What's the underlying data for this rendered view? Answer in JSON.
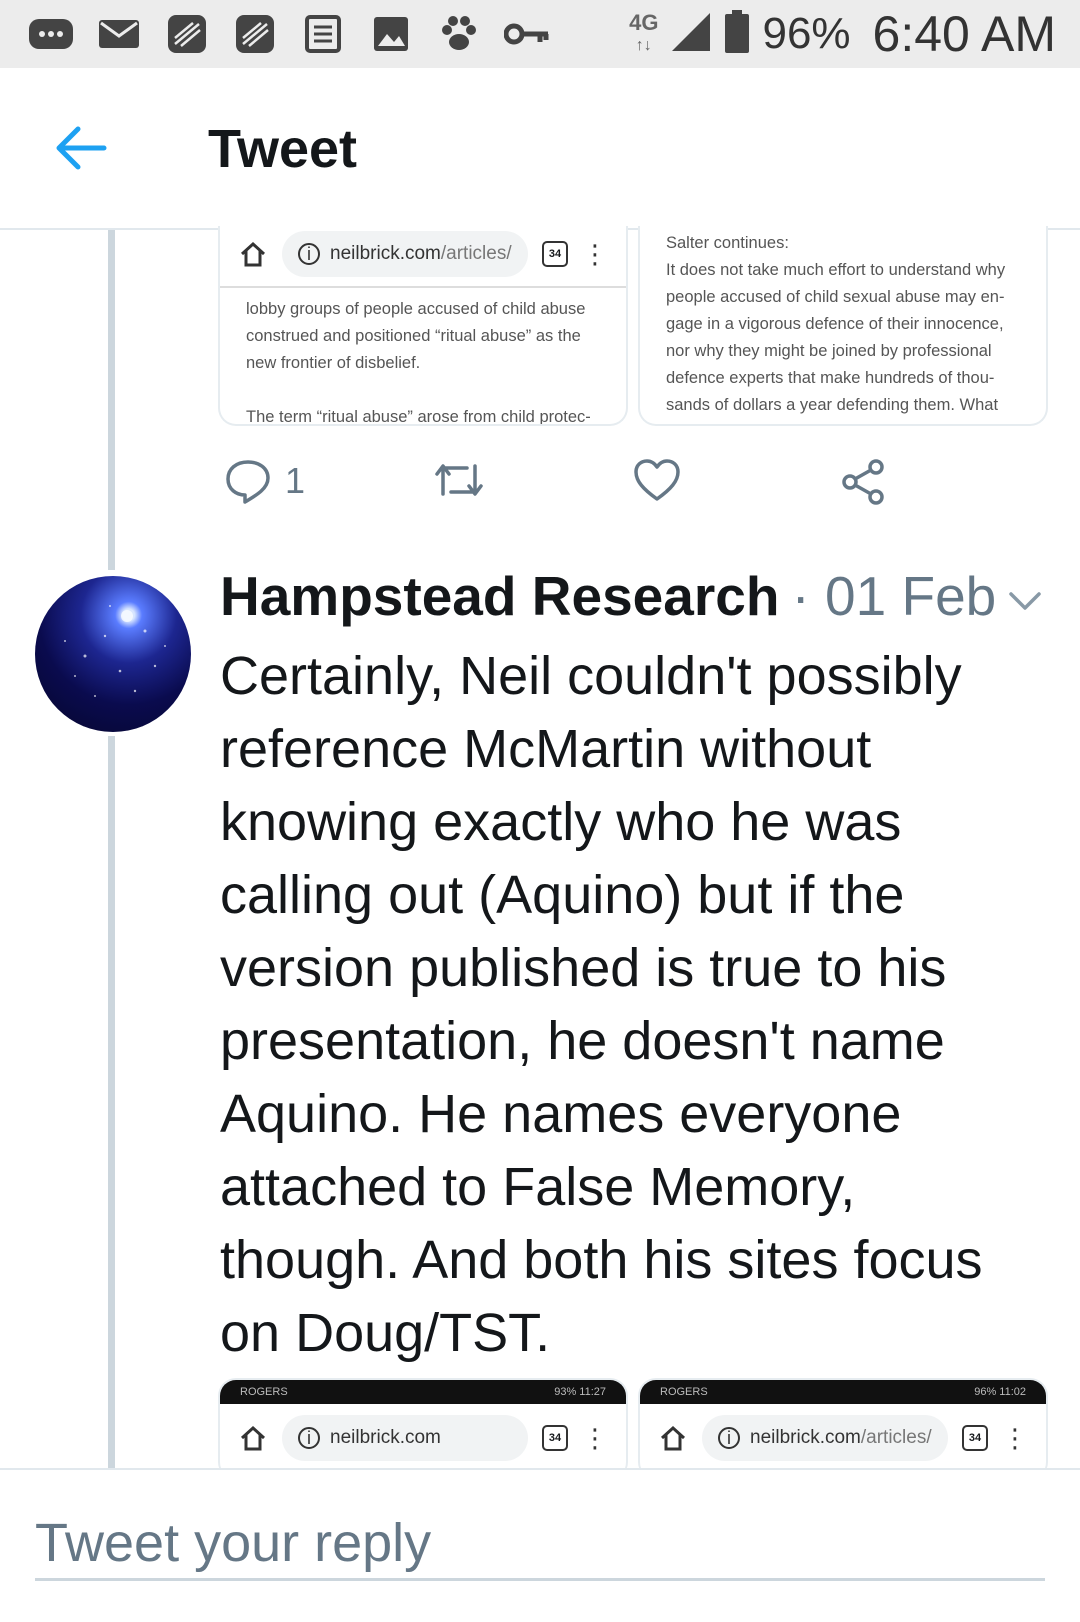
{
  "status_bar": {
    "battery": "96%",
    "time": "6:40 AM",
    "network": "4G",
    "icons": [
      "message-icon",
      "mail-icon",
      "blackberry-icon",
      "blackberry-icon",
      "news-icon",
      "image-icon",
      "paw-icon",
      "key-icon",
      "signal-icon",
      "battery-icon"
    ]
  },
  "header": {
    "title": "Tweet",
    "back_icon": "arrow-left-icon"
  },
  "colors": {
    "accent": "#1da1f2",
    "secondary_text": "#657786",
    "divider": "#e1e8ed"
  },
  "previous_tweet": {
    "card_left": {
      "url_host": "neilbrick.com",
      "url_path": "/articles/",
      "tab_count": "34",
      "lines": [
        "lobby groups of people accused of child abuse",
        "construed and positioned “ritual abuse” as the",
        "new frontier of disbelief.",
        "",
        "The term “ritual abuse” arose from child protec-"
      ]
    },
    "card_right": {
      "lines": [
        "Salter continues:",
        "It does not take much effort to understand why",
        "people accused of child sexual abuse may en-",
        "gage in a vigorous defence of their innocence,",
        "nor why they might be joined by professional",
        "defence experts that make hundreds of thou-",
        "sands of dollars a year defending them. What"
      ]
    },
    "actions": {
      "reply_count": "1"
    }
  },
  "tweet": {
    "author": "Hampstead Research",
    "date": "· 01 Feb",
    "text": "Certainly, Neil couldn't possibly reference McMartin without knowing exactly who he was calling out (Aquino) but if the version published is true to his presentation, he doesn't name Aquino. He names everyone attached to False Memory, though. And both his sites focus on Doug/TST.",
    "media": [
      {
        "carrier": "ROGERS",
        "status": "93% 11:27",
        "url_host": "neilbrick.com",
        "url_path": "",
        "tab_count": "34"
      },
      {
        "carrier": "ROGERS",
        "status": "96% 11:02",
        "url_host": "neilbrick.com",
        "url_path": "/articles/",
        "tab_count": "34"
      }
    ]
  },
  "reply": {
    "placeholder": "Tweet your reply"
  }
}
